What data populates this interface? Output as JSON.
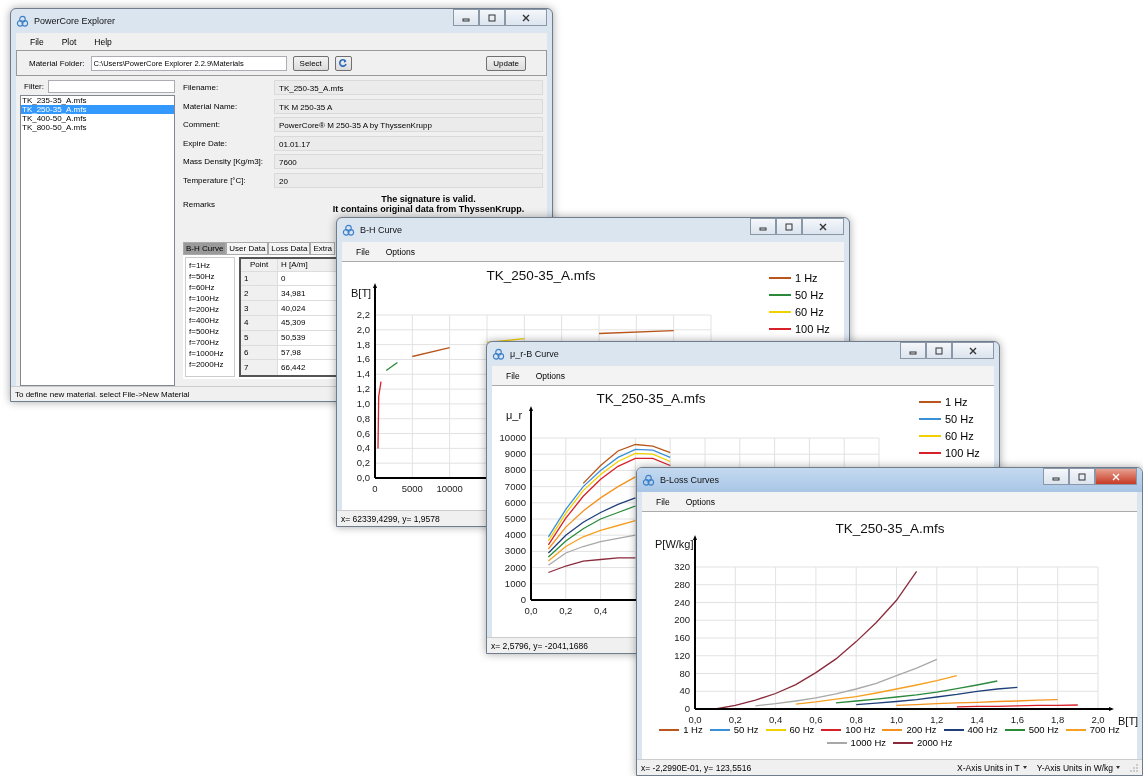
{
  "main_window": {
    "title": "PowerCore Explorer",
    "active": false,
    "menu": [
      "File",
      "Plot",
      "Help"
    ],
    "folder": {
      "label": "Material Folder:",
      "value": "C:\\Users\\PowerCore Explorer 2.2.9\\Materials"
    },
    "select_button": "Select",
    "update_button": "Update",
    "filter": {
      "label": "Filter:"
    },
    "files": [
      {
        "name": "TK_235-35_A.mfs",
        "selected": false
      },
      {
        "name": "TK_250-35_A.mfs",
        "selected": true
      },
      {
        "name": "TK_400-50_A.mfs",
        "selected": false
      },
      {
        "name": "TK_800-50_A.mfs",
        "selected": false
      }
    ],
    "fields": [
      {
        "label": "Filename:",
        "value": "TK_250-35_A.mfs"
      },
      {
        "label": "Material Name:",
        "value": "TK M 250-35 A"
      },
      {
        "label": "Comment:",
        "value": "PowerCore® M 250-35 A by ThyssenKrupp"
      },
      {
        "label": "Expire Date:",
        "value": "01.01.17"
      },
      {
        "label": "Mass Density [Kg/m3]:",
        "value": "7600"
      },
      {
        "label": "Temperature [°C]:",
        "value": "20"
      }
    ],
    "remarks": {
      "label": "Remarks",
      "lines": [
        "The signature is valid.",
        "It contains original data from ThyssenKrupp."
      ]
    },
    "tabs": [
      {
        "label": "B-H Curve",
        "selected": true
      },
      {
        "label": "User Data",
        "selected": false
      },
      {
        "label": "Loss Data",
        "selected": false
      },
      {
        "label": "Extra",
        "selected": false
      }
    ],
    "frequencies": [
      "f=1Hz",
      "f=50Hz",
      "f=60Hz",
      "f=100Hz",
      "f=200Hz",
      "f=400Hz",
      "f=500Hz",
      "f=700Hz",
      "f=1000Hz",
      "f=2000Hz"
    ],
    "table": {
      "columns": [
        "Point",
        "H [A/m]"
      ],
      "rows": [
        [
          "1",
          "0"
        ],
        [
          "2",
          "34,981"
        ],
        [
          "3",
          "40,024"
        ],
        [
          "4",
          "45,309"
        ],
        [
          "5",
          "50,539"
        ],
        [
          "6",
          "57,98"
        ],
        [
          "7",
          "66,442"
        ]
      ]
    },
    "status_bar": "To define new material. select File->New Material"
  },
  "chart_windows": [
    {
      "title": "B-H Curve",
      "active": false,
      "menu": [
        "File",
        "Options"
      ],
      "chart_data": {
        "type": "line",
        "title": "TK_250-35_A.mfs",
        "ylabel": "B[T]",
        "grid": true,
        "legend": "right",
        "x": [
          400,
          500,
          800,
          1500,
          3000,
          5000,
          10000,
          15000,
          20000,
          30000,
          40000
        ],
        "series": [
          {
            "name": "1 Hz",
            "color": "#b8561c",
            "values": [
              null,
              null,
              null,
              null,
              null,
              1.64,
              1.76,
              null,
              null,
              1.95,
              1.99
            ]
          },
          {
            "name": "50 Hz",
            "color": "#2a8a3a",
            "values": [
              null,
              null,
              null,
              1.45,
              1.56,
              null,
              null,
              null,
              null,
              null,
              null
            ]
          },
          {
            "name": "60 Hz",
            "color": "#f2d000",
            "values": [
              null,
              null,
              null,
              null,
              null,
              null,
              null,
              1.83,
              1.88,
              null,
              null
            ]
          },
          {
            "name": "100 Hz",
            "color": "#d8202a",
            "values": [
              0.4,
              1.1,
              1.3,
              null,
              null,
              null,
              null,
              null,
              null,
              null,
              null
            ]
          }
        ],
        "xlim": [
          0,
          45000
        ],
        "ylim": [
          0,
          2.2
        ],
        "xticks": [
          0,
          5000,
          10000
        ],
        "yticks": [
          {
            "value": 0,
            "label": "0,0"
          },
          {
            "value": 0.2,
            "label": "0,2"
          },
          {
            "value": 0.4,
            "label": "0,4"
          },
          {
            "value": 0.6,
            "label": "0,6"
          },
          {
            "value": 0.8,
            "label": "0,8"
          },
          {
            "value": 1,
            "label": "1,0"
          },
          {
            "value": 1.2,
            "label": "1,2"
          },
          {
            "value": 1.4,
            "label": "1,4"
          },
          {
            "value": 1.6,
            "label": "1,6"
          },
          {
            "value": 1.8,
            "label": "1,8"
          },
          {
            "value": 2,
            "label": "2,0"
          },
          {
            "value": 2.2,
            "label": "2,2"
          }
        ]
      },
      "status_bar": {
        "text": "x= 62339,4299, y= 1,9578"
      }
    },
    {
      "title": "μ_r-B Curve",
      "active": false,
      "menu": [
        "File",
        "Options"
      ],
      "chart_data": {
        "type": "line",
        "title": "TK_250-35_A.mfs",
        "ylabel": "μ_r",
        "grid": true,
        "legend": "right",
        "x": [
          0.1,
          0.2,
          0.3,
          0.4,
          0.5,
          0.6,
          0.7,
          0.8
        ],
        "series": [
          {
            "name": "1 Hz",
            "color": "#b8561c",
            "values": [
              null,
              null,
              7200,
              8300,
              9200,
              9600,
              9500,
              9100
            ]
          },
          {
            "name": "50 Hz",
            "color": "#3a8fd6",
            "values": [
              3900,
              5600,
              7000,
              8000,
              8800,
              9300,
              9250,
              8800
            ]
          },
          {
            "name": "60 Hz",
            "color": "#f2d000",
            "values": [
              3650,
              5350,
              6750,
              7750,
              8550,
              9050,
              9000,
              8550
            ]
          },
          {
            "name": "100 Hz",
            "color": "#d8202a",
            "values": [
              3400,
              5050,
              6400,
              7450,
              8250,
              8750,
              8750,
              8300
            ]
          },
          {
            "color": "#f5921e",
            "values": [
              3150,
              4500,
              5500,
              6300,
              7000,
              7600,
              null,
              null
            ]
          },
          {
            "color": "#1f3f7a",
            "values": [
              2900,
              4000,
              4800,
              5400,
              5900,
              6300,
              null,
              null
            ]
          },
          {
            "color": "#2a8a3a",
            "values": [
              2650,
              3650,
              4400,
              5000,
              5400,
              5800,
              null,
              null
            ]
          },
          {
            "color": "#f5a020",
            "values": [
              2400,
              3300,
              3900,
              4300,
              4600,
              4900,
              null,
              null
            ]
          },
          {
            "color": "#a8a8a8",
            "values": [
              2150,
              2900,
              3300,
              3600,
              3800,
              4000,
              null,
              null
            ]
          },
          {
            "color": "#8a2a3a",
            "values": [
              1700,
              2100,
              2400,
              2500,
              2600,
              2600,
              null,
              null
            ]
          }
        ],
        "xlim": [
          0,
          2
        ],
        "ylim": [
          0,
          10000
        ],
        "xticks": [
          {
            "value": 0,
            "label": "0,0"
          },
          {
            "value": 0.2,
            "label": "0,2"
          },
          {
            "value": 0.4,
            "label": "0,4"
          }
        ],
        "yticks": [
          0,
          1000,
          2000,
          3000,
          4000,
          5000,
          6000,
          7000,
          8000,
          9000,
          10000
        ]
      },
      "status_bar": {
        "text": "x= 2,5796, y= -2041,1686"
      }
    },
    {
      "title": "B-Loss Curves",
      "active": true,
      "menu": [
        "File",
        "Options"
      ],
      "chart_data": {
        "type": "line",
        "title": "TK_250-35_A.mfs",
        "xlabel": "B[T]",
        "ylabel": "P[W/kg]",
        "grid": true,
        "legend": "bottom",
        "x": [
          0.1,
          0.2,
          0.3,
          0.4,
          0.5,
          0.6,
          0.7,
          0.8,
          0.9,
          1.0,
          1.1,
          1.2,
          1.3,
          1.4,
          1.5,
          1.6,
          1.7,
          1.8,
          1.9
        ],
        "series": [
          {
            "name": "1 Hz",
            "color": "#b8561c",
            "values": [
              null,
              null,
              null,
              null,
              null,
              null,
              null,
              null,
              null,
              null,
              null,
              null,
              null,
              null,
              null,
              null,
              null,
              null,
              null
            ]
          },
          {
            "name": "50 Hz",
            "color": "#3a8fd6",
            "values": [
              null,
              null,
              null,
              null,
              null,
              null,
              null,
              null,
              null,
              null,
              null,
              null,
              null,
              null,
              null,
              null,
              null,
              null,
              null
            ]
          },
          {
            "name": "60 Hz",
            "color": "#f2d000",
            "values": [
              null,
              null,
              null,
              null,
              null,
              null,
              null,
              null,
              null,
              null,
              null,
              null,
              null,
              null,
              null,
              null,
              null,
              null,
              null
            ]
          },
          {
            "name": "100 Hz",
            "color": "#d8202a",
            "values": [
              null,
              null,
              null,
              null,
              null,
              null,
              null,
              null,
              null,
              null,
              null,
              null,
              5,
              6,
              6,
              7,
              8,
              8,
              9
            ]
          },
          {
            "name": "200 Hz",
            "color": "#f5921e",
            "values": [
              null,
              null,
              null,
              null,
              null,
              null,
              null,
              null,
              null,
              8,
              10,
              12,
              14,
              15,
              17,
              18,
              20,
              21,
              null
            ]
          },
          {
            "name": "400 Hz",
            "color": "#1f3f7a",
            "values": [
              null,
              null,
              null,
              null,
              null,
              null,
              null,
              10,
              13,
              17,
              21,
              27,
              33,
              40,
              45,
              49,
              null,
              null,
              null
            ]
          },
          {
            "name": "500 Hz",
            "color": "#2a8a3a",
            "values": [
              null,
              null,
              null,
              null,
              null,
              null,
              14,
              18,
              22,
              27,
              32,
              38,
              46,
              54,
              63,
              null,
              null,
              null,
              null
            ]
          },
          {
            "name": "700 Hz",
            "color": "#f5a020",
            "values": [
              null,
              null,
              null,
              null,
              11,
              16,
              22,
              28,
              36,
              45,
              54,
              64,
              75,
              null,
              null,
              null,
              null,
              null,
              null
            ]
          },
          {
            "name": "1000 Hz",
            "color": "#a8a8a8",
            "values": [
              null,
              null,
              7,
              12,
              18,
              25,
              34,
              45,
              58,
              75,
              92,
              112,
              null,
              null,
              null,
              null,
              null,
              null,
              null
            ]
          },
          {
            "name": "2000 Hz",
            "color": "#8a2a3a",
            "values": [
              0,
              8,
              20,
              35,
              55,
              82,
              113,
              152,
              195,
              245,
              310,
              null,
              null,
              null,
              null,
              null,
              null,
              null,
              null
            ]
          }
        ],
        "xlim": [
          0,
          2
        ],
        "ylim": [
          0,
          320
        ],
        "xticks": [
          {
            "value": 0,
            "label": "0,0"
          },
          {
            "value": 0.2,
            "label": "0,2"
          },
          {
            "value": 0.4,
            "label": "0,4"
          },
          {
            "value": 0.6,
            "label": "0,6"
          },
          {
            "value": 0.8,
            "label": "0,8"
          },
          {
            "value": 1,
            "label": "1,0"
          },
          {
            "value": 1.2,
            "label": "1,2"
          },
          {
            "value": 1.4,
            "label": "1,4"
          },
          {
            "value": 1.6,
            "label": "1,6"
          },
          {
            "value": 1.8,
            "label": "1,8"
          },
          {
            "value": 2,
            "label": "2,0"
          }
        ],
        "yticks": [
          0,
          40,
          80,
          120,
          160,
          200,
          240,
          280,
          320
        ]
      },
      "status_bar": {
        "text": "x= -2,2990E-01, y= 123,5516",
        "units": [
          "X-Axis Units in T",
          "Y-Axis Units in W/kg"
        ]
      }
    }
  ]
}
